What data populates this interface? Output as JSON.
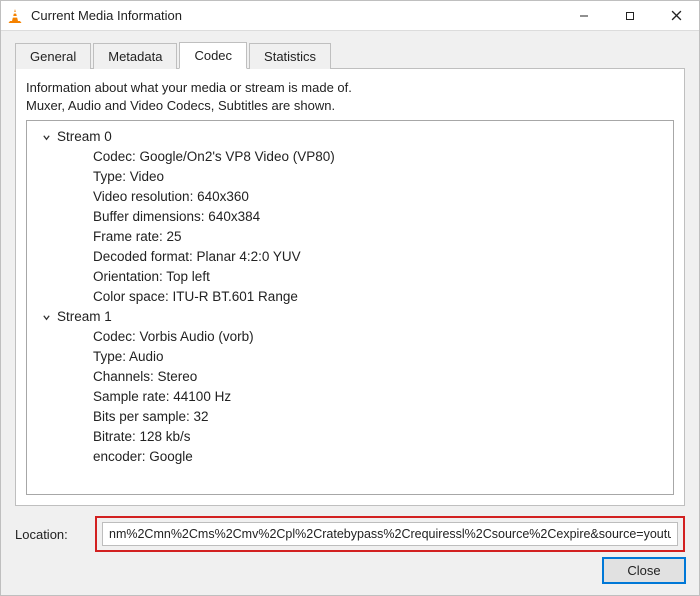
{
  "window": {
    "title": "Current Media Information"
  },
  "tabs": {
    "general": "General",
    "metadata": "Metadata",
    "codec": "Codec",
    "statistics": "Statistics"
  },
  "description": {
    "line1": "Information about what your media or stream is made of.",
    "line2": "Muxer, Audio and Video Codecs, Subtitles are shown."
  },
  "streams": {
    "s0": {
      "header": "Stream 0",
      "codec_label": "Codec: Google/On2's VP8 Video (VP80)",
      "type_label": "Type: Video",
      "resolution_label": "Video resolution: 640x360",
      "buffer_label": "Buffer dimensions: 640x384",
      "framerate_label": "Frame rate: 25",
      "decoded_label": "Decoded format: Planar 4:2:0 YUV",
      "orientation_label": "Orientation: Top left",
      "colorspace_label": "Color space: ITU-R BT.601 Range"
    },
    "s1": {
      "header": "Stream 1",
      "codec_label": "Codec: Vorbis Audio (vorb)",
      "type_label": "Type: Audio",
      "channels_label": "Channels: Stereo",
      "samplerate_label": "Sample rate: 44100 Hz",
      "bits_label": "Bits per sample: 32",
      "bitrate_label": "Bitrate: 128 kb/s",
      "encoder_label": "encoder: Google"
    }
  },
  "footer": {
    "location_label": "Location:",
    "location_value": "nm%2Cmn%2Cms%2Cmv%2Cpl%2Cratebypass%2Crequiressl%2Csource%2Cexpire&source=youtube",
    "close_label": "Close"
  }
}
